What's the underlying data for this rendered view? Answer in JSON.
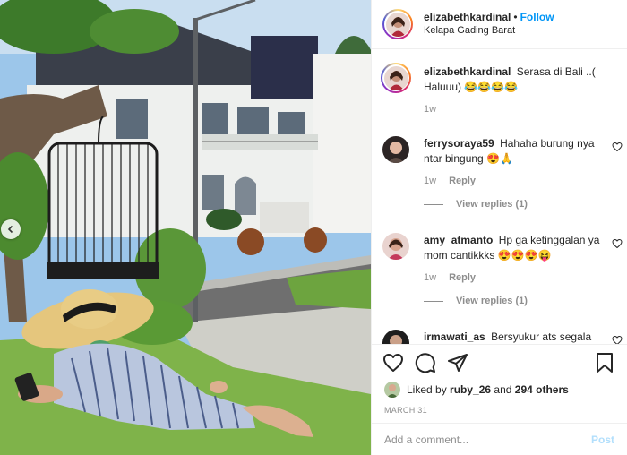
{
  "post": {
    "username": "elizabethkardinal",
    "separator": "•",
    "follow_label": "Follow",
    "location": "Kelapa Gading Barat"
  },
  "caption": {
    "username": "elizabethkardinal",
    "text": "Serasa di Bali ..( Haluuu) 😂😂😂😂",
    "time": "1w"
  },
  "comments": [
    {
      "username": "ferrysoraya59",
      "text": "Hahaha burung nya ntar bingung 😍🙏",
      "time": "1w",
      "reply_label": "Reply",
      "view_replies": "View replies (1)"
    },
    {
      "username": "amy_atmanto",
      "text": "Hp ga ketinggalan ya mom cantikkks 😍😍😍😝",
      "time": "1w",
      "reply_label": "Reply",
      "view_replies": "View replies (1)"
    },
    {
      "username": "irmawati_as",
      "text": "Bersyukur ats segala"
    }
  ],
  "likes": {
    "prefix": "Liked by",
    "user": "ruby_26",
    "middle": "and",
    "count": "294 others"
  },
  "date": "MARCH 31",
  "add_comment": {
    "placeholder": "Add a comment...",
    "post_label": "Post"
  },
  "icons": [
    "chevron-left-icon",
    "heart-icon",
    "comment-icon",
    "share-icon",
    "bookmark-icon"
  ],
  "colors": {
    "link": "#0095f6",
    "post_disabled": "#b2dffc",
    "muted": "#8e8e8e"
  }
}
